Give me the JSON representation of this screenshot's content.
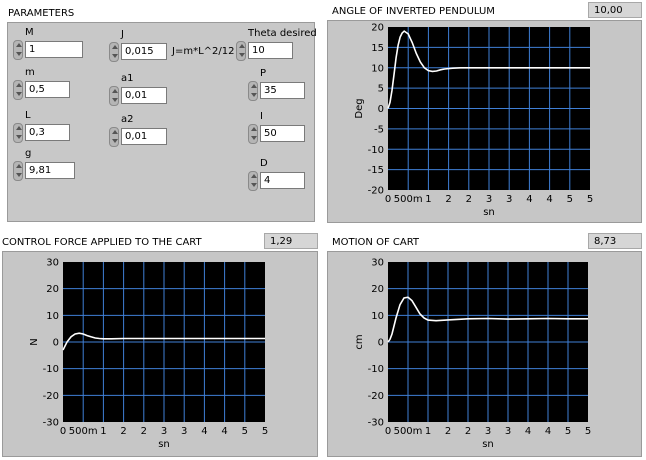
{
  "parameters": {
    "title": "PARAMETERS",
    "M": {
      "label": "M",
      "value": "1"
    },
    "m": {
      "label": "m",
      "value": "0,5"
    },
    "L": {
      "label": "L",
      "value": "0,3"
    },
    "g": {
      "label": "g",
      "value": "9,81"
    },
    "J": {
      "label": "J",
      "value": "0,015"
    },
    "a1": {
      "label": "a1",
      "value": "0,01"
    },
    "a2": {
      "label": "a2",
      "value": "0,01"
    },
    "formula": "J=m*L^2/12",
    "theta": {
      "label": "Theta desired",
      "value": "10"
    },
    "P": {
      "label": "P",
      "value": "35"
    },
    "I": {
      "label": "I",
      "value": "50"
    },
    "D": {
      "label": "D",
      "value": "4"
    }
  },
  "colors": {
    "plot_bg": "#000000",
    "grid": "#3f7fd6",
    "trace": "#ffffff",
    "frame": "#c6c6c6"
  },
  "chart_data": [
    {
      "id": "angle",
      "type": "line",
      "title": "ANGLE OF INVERTED PENDULUM",
      "indicator": "10,00",
      "xlabel": "sn",
      "ylabel": "Deg",
      "xlim": [
        0,
        5
      ],
      "ylim": [
        -20,
        20
      ],
      "xticks": [
        {
          "v": 0,
          "t": "0"
        },
        {
          "v": 0.5,
          "t": "500m"
        },
        {
          "v": 1,
          "t": "1"
        },
        {
          "v": 1.5,
          "t": "2"
        },
        {
          "v": 2,
          "t": "2"
        },
        {
          "v": 2.5,
          "t": "3"
        },
        {
          "v": 3,
          "t": "3"
        },
        {
          "v": 3.5,
          "t": "4"
        },
        {
          "v": 4,
          "t": "4"
        },
        {
          "v": 4.5,
          "t": "5"
        },
        {
          "v": 5,
          "t": "5"
        }
      ],
      "yticks": [
        20,
        15,
        10,
        5,
        0,
        -5,
        -10,
        -15,
        -20
      ],
      "grid": true,
      "series": [
        {
          "x": [
            0,
            0.05,
            0.1,
            0.15,
            0.2,
            0.25,
            0.3,
            0.35,
            0.4,
            0.5,
            0.6,
            0.7,
            0.8,
            0.9,
            1.0,
            1.1,
            1.2,
            1.3,
            1.4,
            1.6,
            1.8,
            2.0,
            2.5,
            3.0,
            4.0,
            5.0
          ],
          "y": [
            0,
            1.5,
            4.5,
            8.5,
            12.5,
            15.5,
            17.5,
            18.5,
            19,
            18.3,
            16.2,
            13.5,
            11.4,
            10,
            9.3,
            9.1,
            9.2,
            9.5,
            9.7,
            9.9,
            10,
            10,
            10,
            10,
            10,
            10
          ]
        }
      ]
    },
    {
      "id": "force",
      "type": "line",
      "title": "CONTROL FORCE APPLIED TO THE CART",
      "indicator": "1,29",
      "xlabel": "sn",
      "ylabel": "N",
      "xlim": [
        0,
        5
      ],
      "ylim": [
        -30,
        30
      ],
      "xticks": [
        {
          "v": 0,
          "t": "0"
        },
        {
          "v": 0.5,
          "t": "500m"
        },
        {
          "v": 1,
          "t": "1"
        },
        {
          "v": 1.5,
          "t": "2"
        },
        {
          "v": 2,
          "t": "2"
        },
        {
          "v": 2.5,
          "t": "3"
        },
        {
          "v": 3,
          "t": "3"
        },
        {
          "v": 3.5,
          "t": "4"
        },
        {
          "v": 4,
          "t": "4"
        },
        {
          "v": 4.5,
          "t": "5"
        },
        {
          "v": 5,
          "t": "5"
        }
      ],
      "yticks": [
        30,
        20,
        10,
        0,
        -10,
        -20,
        -30
      ],
      "grid": true,
      "series": [
        {
          "x": [
            0,
            0.05,
            0.1,
            0.15,
            0.2,
            0.3,
            0.4,
            0.5,
            0.6,
            0.7,
            0.8,
            0.9,
            1.0,
            1.2,
            1.5,
            2.0,
            3.0,
            4.0,
            5.0
          ],
          "y": [
            -3,
            -1.5,
            0,
            1,
            2,
            3,
            3.3,
            3,
            2.4,
            1.9,
            1.5,
            1.3,
            1.2,
            1.2,
            1.3,
            1.3,
            1.3,
            1.3,
            1.3
          ]
        }
      ]
    },
    {
      "id": "cart",
      "type": "line",
      "title": "MOTION OF CART",
      "indicator": "8,73",
      "xlabel": "sn",
      "ylabel": "cm",
      "xlim": [
        0,
        5
      ],
      "ylim": [
        -30,
        30
      ],
      "xticks": [
        {
          "v": 0,
          "t": "0"
        },
        {
          "v": 0.5,
          "t": "500m"
        },
        {
          "v": 1,
          "t": "1"
        },
        {
          "v": 1.5,
          "t": "2"
        },
        {
          "v": 2,
          "t": "2"
        },
        {
          "v": 2.5,
          "t": "3"
        },
        {
          "v": 3,
          "t": "3"
        },
        {
          "v": 3.5,
          "t": "4"
        },
        {
          "v": 4,
          "t": "4"
        },
        {
          "v": 4.5,
          "t": "5"
        },
        {
          "v": 5,
          "t": "5"
        }
      ],
      "yticks": [
        30,
        20,
        10,
        0,
        -10,
        -20,
        -30
      ],
      "grid": true,
      "series": [
        {
          "x": [
            0,
            0.05,
            0.1,
            0.2,
            0.3,
            0.4,
            0.5,
            0.6,
            0.7,
            0.8,
            0.9,
            1.0,
            1.2,
            1.5,
            2.0,
            2.5,
            3.0,
            3.5,
            4.0,
            4.5,
            5.0
          ],
          "y": [
            0,
            1,
            3,
            9,
            14,
            16.5,
            16.8,
            15.5,
            13,
            10.5,
            9,
            8.2,
            8,
            8.3,
            8.7,
            8.8,
            8.6,
            8.7,
            8.8,
            8.7,
            8.7
          ]
        }
      ]
    }
  ]
}
